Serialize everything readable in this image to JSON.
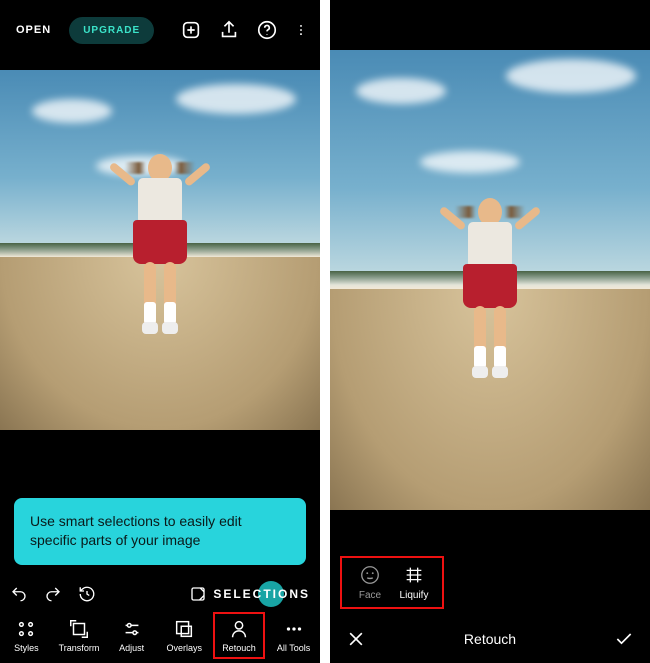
{
  "left": {
    "open_label": "OPEN",
    "upgrade_label": "UPGRADE",
    "tooltip_text": "Use smart selections to easily edit specific parts of your image",
    "selections_label": "SELECTIONS",
    "tools": {
      "styles": "Styles",
      "transform": "Transform",
      "adjust": "Adjust",
      "overlays": "Overlays",
      "retouch": "Retouch",
      "alltools": "All Tools"
    }
  },
  "right": {
    "tools": {
      "face": "Face",
      "liquify": "Liquify"
    },
    "title": "Retouch"
  }
}
